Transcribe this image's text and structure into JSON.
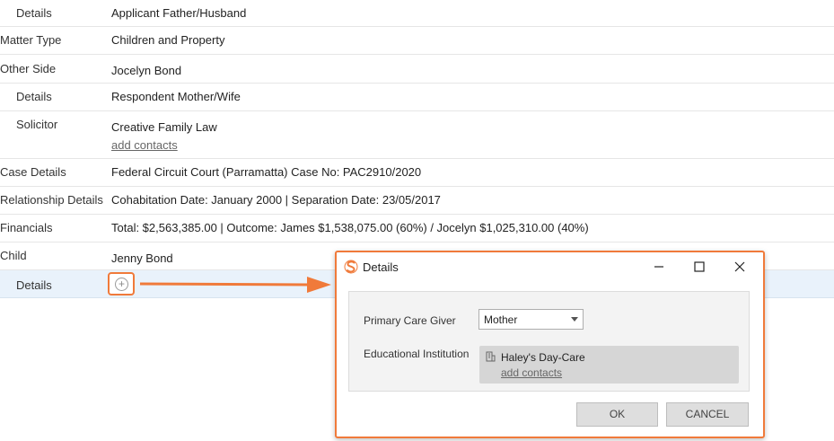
{
  "rows": [
    {
      "label": "Details",
      "value": "Applicant Father/Husband"
    },
    {
      "label": "Matter Type",
      "value": "Children and Property"
    },
    {
      "label": "Other Side",
      "value": "Jocelyn Bond"
    },
    {
      "label": "Details",
      "value": "Respondent Mother/Wife"
    },
    {
      "label": "Solicitor",
      "value": "Creative Family Law",
      "link": "add contacts"
    },
    {
      "label": "Case Details",
      "value": "Federal Circuit Court (Parramatta) Case No: PAC2910/2020"
    },
    {
      "label": "Relationship Details",
      "value": "Cohabitation Date: January 2000 | Separation Date: 23/05/2017"
    },
    {
      "label": "Financials",
      "value": "Total: $2,563,385.00 | Outcome: James $1,538,075.00 (60%) / Jocelyn $1,025,310.00 (40%)"
    },
    {
      "label": "Child",
      "value": "Jenny Bond"
    },
    {
      "label": "Details",
      "value": ""
    }
  ],
  "add_icon": "plus-circle-icon",
  "dialog": {
    "title": "Details",
    "primary_care_label": "Primary Care Giver",
    "primary_care_value": "Mother",
    "education_label": "Educational Institution",
    "education_value": "Haley's Day-Care",
    "education_link": "add contacts",
    "ok_label": "OK",
    "cancel_label": "CANCEL"
  },
  "colors": {
    "highlight": "#f07a3a",
    "selected_row": "#e9f2fb"
  }
}
